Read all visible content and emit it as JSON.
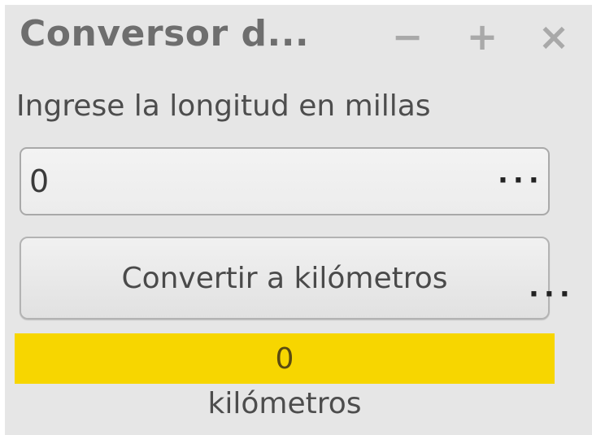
{
  "window": {
    "title": "Conversor d...",
    "minimize_label": "−",
    "maximize_label": "+",
    "close_label": "×"
  },
  "form": {
    "prompt": "Ingrese la longitud en millas",
    "input_value": "0",
    "more_indicator_input": "···",
    "convert_button_label": "Convertir a kilómetros",
    "more_indicator_button": "···"
  },
  "result": {
    "value": "0",
    "unit": "kilómetros"
  },
  "colors": {
    "result_background": "#f7d600",
    "window_background": "#e6e6e6"
  }
}
